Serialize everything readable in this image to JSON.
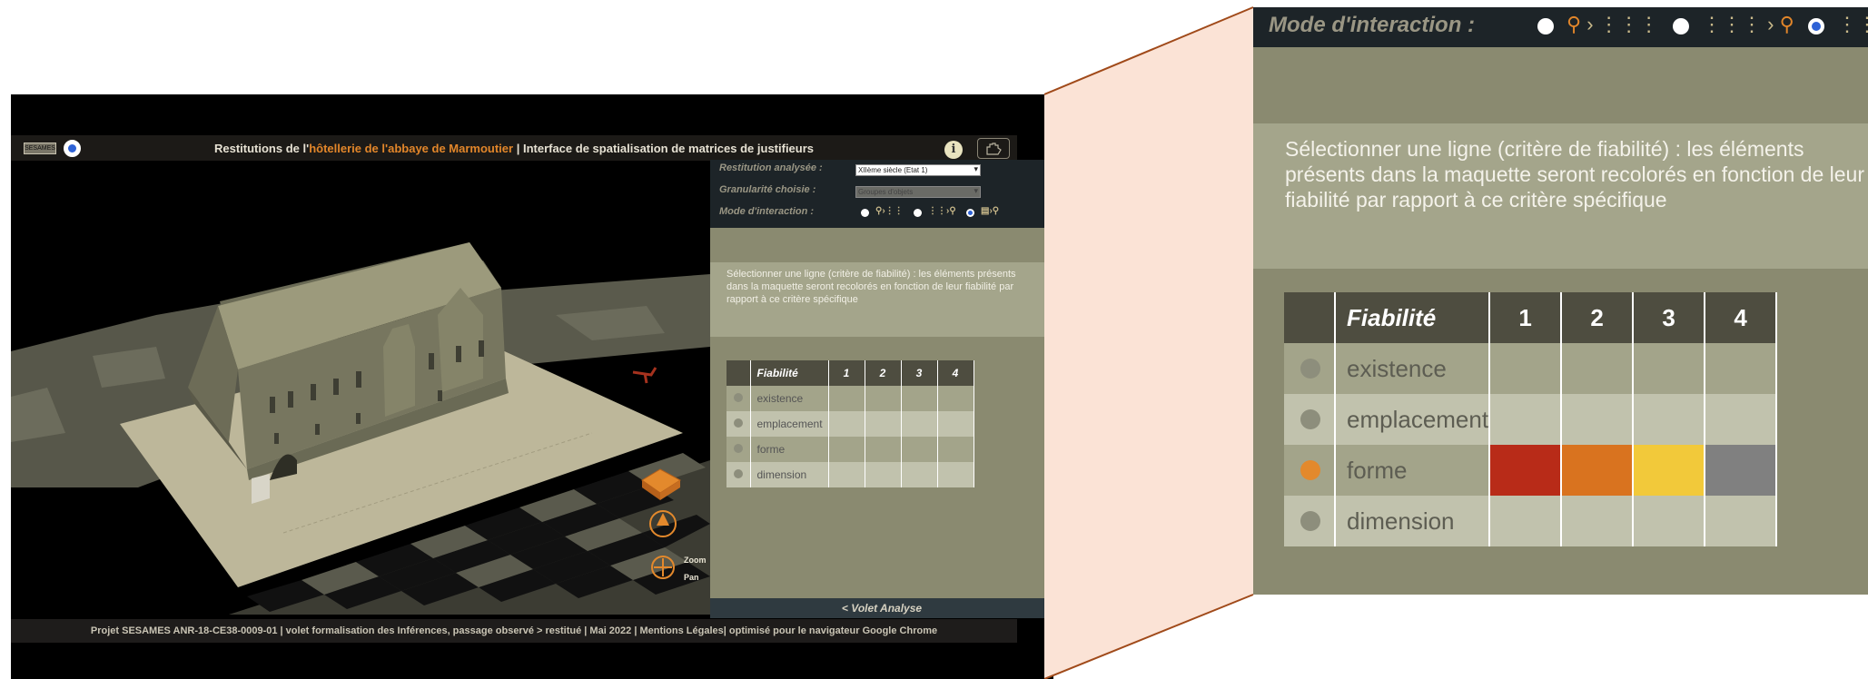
{
  "app": {
    "logo_text": "SESAMES",
    "title_prefix": "Restitutions de l'",
    "title_highlight": "hôtellerie de l'abbaye de Marmoutier",
    "title_suffix": " | Interface de spatialisation de matrices de justifieurs",
    "info_label": "i",
    "controls": {
      "restitution_label": "Restitution analysée :",
      "restitution_value": "XIIème siècle (Etat 1)",
      "granularity_label": "Granularité choisie :",
      "granularity_value": "Groupes d'objets",
      "mode_label": "Mode d'interaction :"
    },
    "nav": {
      "zoom": "Zoom",
      "pan": "Pan"
    },
    "panel": {
      "instruction": "Sélectionner une ligne (critère de fiabilité) : les éléments présents dans la maquette seront recolorés en fonction de leur fiabilité par rapport à ce critère spécifique",
      "table": {
        "headers": [
          "Fiabilité",
          "1",
          "2",
          "3",
          "4"
        ],
        "rows": [
          "existence",
          "emplacement",
          "forme",
          "dimension"
        ]
      }
    },
    "volet_label": "< Volet Analyse",
    "footer": "Projet SESAMES ANR-18-CE38-0009-01 | volet formalisation des Inférences, passage observé > restitué | Mai 2022 | Mentions Légales| optimisé pour le navigateur Google Chrome"
  },
  "zoom": {
    "mode_label": "Mode d'interaction :",
    "instruction": "Sélectionner une ligne (critère de fiabilité) : les éléments présents dans la maquette seront recolorés en fonction de leur fiabilité par rapport à ce critère spécifique",
    "table": {
      "headers": [
        "Fiabilité",
        "1",
        "2",
        "3",
        "4"
      ],
      "rows": [
        {
          "label": "existence",
          "selected": false
        },
        {
          "label": "emplacement",
          "selected": false
        },
        {
          "label": "forme",
          "selected": true,
          "colors": [
            "#b82b18",
            "#d9731f",
            "#f2c93a",
            "#808080"
          ]
        },
        {
          "label": "dimension",
          "selected": false
        }
      ]
    },
    "selected_mode": 3
  },
  "colors": {
    "accent_orange": "#e2862a",
    "panel_bg": "#8a8a70",
    "toolbar_bg": "#1d2428",
    "connector_fill": "#fbe3d6",
    "connector_stroke": "#a04a1a"
  }
}
